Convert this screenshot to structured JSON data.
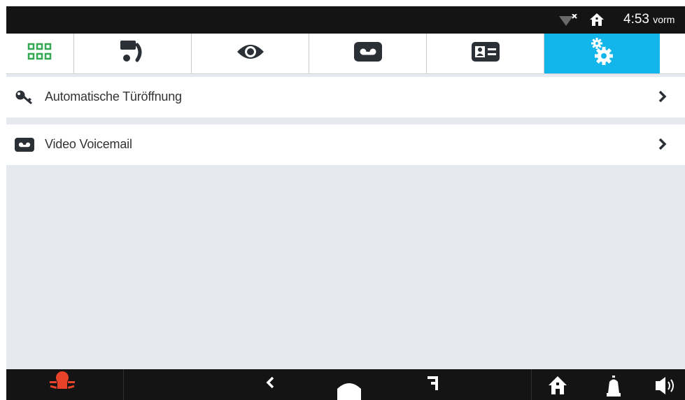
{
  "status": {
    "time": "4:53",
    "ampm": "vorm",
    "icons": [
      "wifi-off-icon",
      "home-icon"
    ]
  },
  "tabs": [
    {
      "icon": "apps-grid-icon",
      "color": "#35a853"
    },
    {
      "icon": "intercom-call-icon"
    },
    {
      "icon": "eye-icon"
    },
    {
      "icon": "voicemail-icon"
    },
    {
      "icon": "contact-card-icon"
    },
    {
      "icon": "settings-gears-icon",
      "active": true
    }
  ],
  "list": [
    {
      "icon": "key-icon",
      "label": "Automatische Türöffnung"
    },
    {
      "icon": "voicemail-icon",
      "label": "Video Voicemail"
    }
  ],
  "nav": {
    "icons": [
      "alarm-panic-icon",
      "back-icon",
      "home-icon",
      "recent-apps-icon",
      "house-icon",
      "bell-icon",
      "speaker-icon"
    ],
    "alarm_color": "#e8432a"
  },
  "colors": {
    "accent": "#12b6ea",
    "statusbar": "#141414",
    "background": "#e6e9ef"
  }
}
